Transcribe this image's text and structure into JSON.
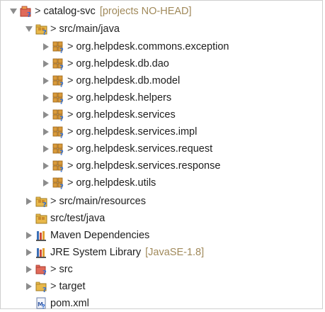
{
  "tree": {
    "project": {
      "label": "catalog-svc",
      "decoration": "[projects NO-HEAD]",
      "prefix": ">",
      "icon": "project-folder-icon"
    },
    "src_main_java": {
      "label": "src/main/java",
      "prefix": ">",
      "icon": "source-folder-icon"
    },
    "packages": [
      {
        "label": "org.helpdesk.commons.exception",
        "prefix": ">",
        "icon": "package-icon"
      },
      {
        "label": "org.helpdesk.db.dao",
        "prefix": ">",
        "icon": "package-icon"
      },
      {
        "label": "org.helpdesk.db.model",
        "prefix": ">",
        "icon": "package-icon"
      },
      {
        "label": "org.helpdesk.helpers",
        "prefix": ">",
        "icon": "package-icon"
      },
      {
        "label": "org.helpdesk.services",
        "prefix": ">",
        "icon": "package-icon"
      },
      {
        "label": "org.helpdesk.services.impl",
        "prefix": ">",
        "icon": "package-icon"
      },
      {
        "label": "org.helpdesk.services.request",
        "prefix": ">",
        "icon": "package-icon"
      },
      {
        "label": "org.helpdesk.services.response",
        "prefix": ">",
        "icon": "package-icon"
      },
      {
        "label": "org.helpdesk.utils",
        "prefix": ">",
        "icon": "package-icon"
      }
    ],
    "src_main_resources": {
      "label": "src/main/resources",
      "prefix": ">",
      "icon": "source-folder-icon"
    },
    "src_test_java": {
      "label": "src/test/java",
      "icon": "source-folder-icon"
    },
    "maven_deps": {
      "label": "Maven Dependencies",
      "icon": "library-icon"
    },
    "jre": {
      "label": "JRE System Library",
      "decoration": "[JavaSE-1.8]",
      "icon": "library-icon"
    },
    "src": {
      "label": "src",
      "prefix": ">",
      "icon": "folder-icon"
    },
    "target": {
      "label": "target",
      "prefix": ">",
      "icon": "folder-icon"
    },
    "pom": {
      "label": "pom.xml",
      "icon": "xml-file-icon"
    }
  },
  "colors": {
    "decoration": "#a0895a",
    "twisty": "#8c8c8c",
    "package": "#c98a2e",
    "folder": "#e8b84a",
    "question": "#2f6fd6"
  }
}
